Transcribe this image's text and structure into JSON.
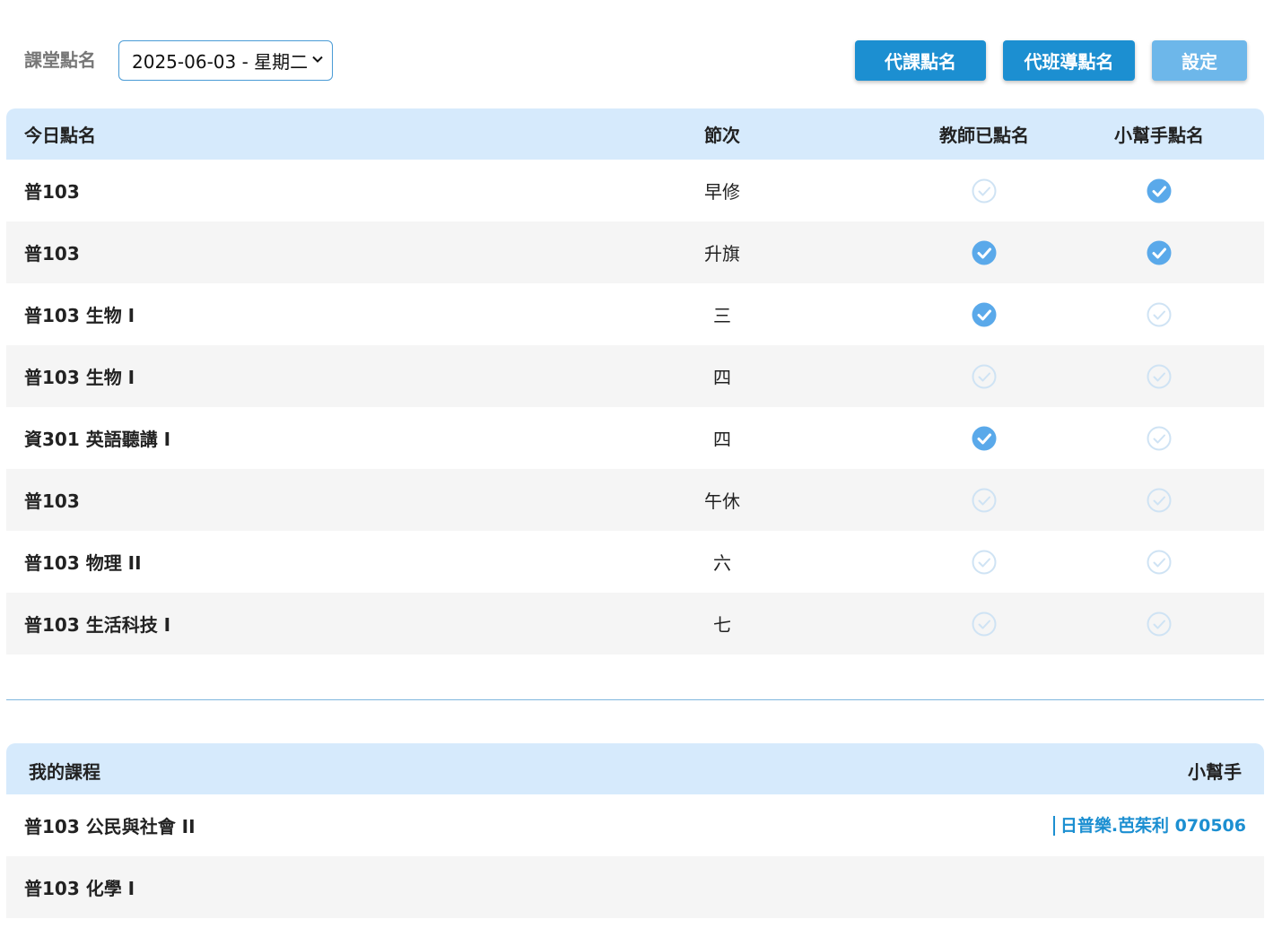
{
  "header": {
    "page_label": "課堂點名",
    "date_value": "2025-06-03 - 星期二",
    "buttons": {
      "substitute": "代課點名",
      "substitute_homeroom": "代班導點名",
      "settings": "設定"
    }
  },
  "today": {
    "columns": {
      "name": "今日點名",
      "period": "節次",
      "teacher": "教師已點名",
      "helper": "小幫手點名"
    },
    "rows": [
      {
        "name": "普103",
        "period": "早修",
        "teacher_checked": false,
        "helper_checked": true
      },
      {
        "name": "普103",
        "period": "升旗",
        "teacher_checked": true,
        "helper_checked": true
      },
      {
        "name": "普103 生物 I",
        "period": "三",
        "teacher_checked": true,
        "helper_checked": false
      },
      {
        "name": "普103 生物 I",
        "period": "四",
        "teacher_checked": false,
        "helper_checked": false
      },
      {
        "name": "資301 英語聽講 I",
        "period": "四",
        "teacher_checked": true,
        "helper_checked": false
      },
      {
        "name": "普103",
        "period": "午休",
        "teacher_checked": false,
        "helper_checked": false
      },
      {
        "name": "普103 物理 II",
        "period": "六",
        "teacher_checked": false,
        "helper_checked": false
      },
      {
        "name": "普103 生活科技 I",
        "period": "七",
        "teacher_checked": false,
        "helper_checked": false
      }
    ]
  },
  "courses": {
    "columns": {
      "name": "我的課程",
      "helper": "小幫手"
    },
    "rows": [
      {
        "name": "普103 公民與社會 II",
        "helper": "日普樂.芭茱利 070506"
      },
      {
        "name": "普103 化學 I",
        "helper": ""
      }
    ]
  },
  "colors": {
    "accent": "#1c8fd1",
    "check_on": "#5aa9ea",
    "check_off": "#cfe3f4",
    "header_bg": "#d6eafc"
  }
}
